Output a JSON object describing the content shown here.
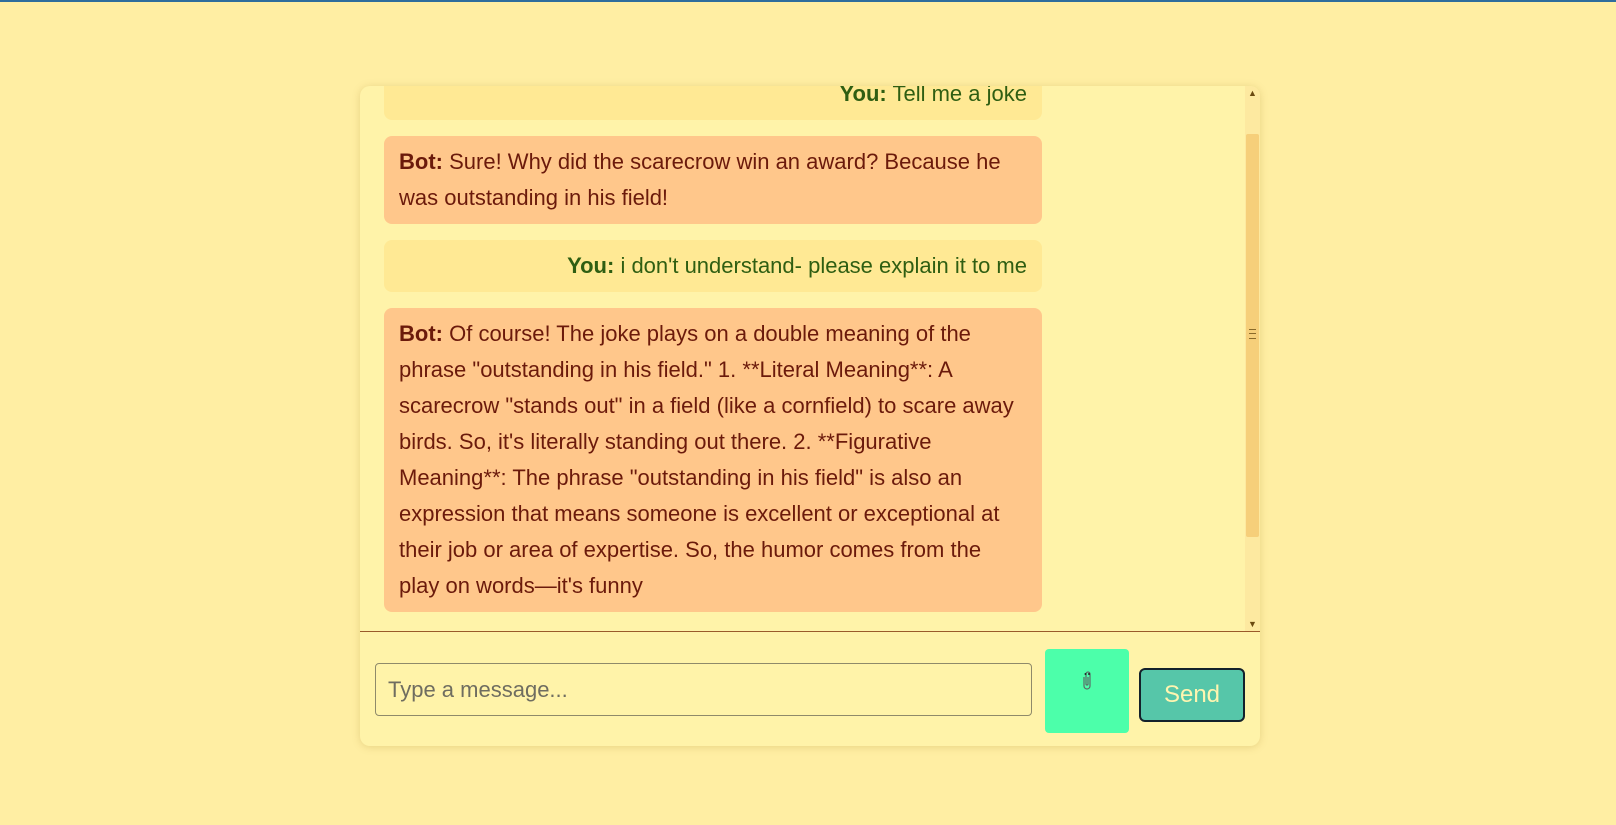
{
  "chat": {
    "messages": [
      {
        "role": "user",
        "speaker": "You:",
        "text": "Tell me a joke"
      },
      {
        "role": "bot",
        "speaker": "Bot:",
        "text": "Sure! Why did the scarecrow win an award? Because he was outstanding in his field!"
      },
      {
        "role": "user",
        "speaker": "You:",
        "text": "i don't understand- please explain it to me"
      },
      {
        "role": "bot",
        "speaker": "Bot:",
        "text": "Of course! The joke plays on a double meaning of the phrase \"outstanding in his field.\" 1. **Literal Meaning**: A scarecrow \"stands out\" in a field (like a cornfield) to scare away birds. So, it's literally standing out there. 2. **Figurative Meaning**: The phrase \"outstanding in his field\" is also an expression that means someone is excellent or exceptional at their job or area of expertise. So, the humor comes from the play on words—it's funny"
      }
    ]
  },
  "input": {
    "placeholder": "Type a message...",
    "value": ""
  },
  "buttons": {
    "attach_icon": "paperclip-icon",
    "send_label": "Send"
  },
  "colors": {
    "page_background": "#ffeea3",
    "user_bubble": "#ffe994",
    "bot_bubble": "#ffc78b",
    "user_text": "#2f5e12",
    "bot_text": "#6b1a0b",
    "attach_button": "#4cffaa",
    "send_button": "#56c6a9"
  }
}
